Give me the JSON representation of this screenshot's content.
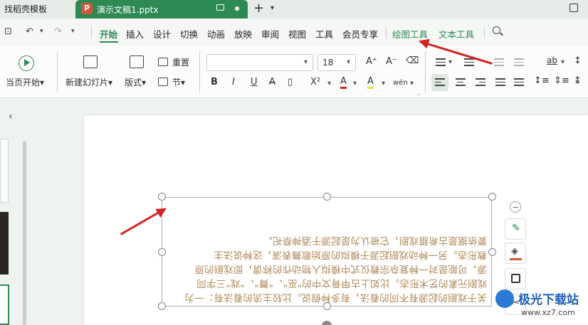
{
  "titlebar": {
    "tab_template": "找稻壳模板",
    "tab_doc": "演示文稿1.pptx",
    "doc_icon_letter": "P",
    "new_tab": "+"
  },
  "menu": {
    "items": [
      "开始",
      "插入",
      "设计",
      "切换",
      "动画",
      "放映",
      "审阅",
      "视图",
      "工具",
      "会员专享"
    ],
    "context_items": [
      "绘图工具",
      "文本工具"
    ],
    "active": "开始"
  },
  "ribbon": {
    "start_from_first": "当页开始",
    "new_slide": "新建幻灯片",
    "layout": "版式",
    "reset": "重置",
    "section": "节",
    "font_name": "",
    "font_size": "18",
    "format_buttons": [
      "B",
      "I",
      "U",
      "A",
      "X²",
      "A",
      "A",
      "ab"
    ],
    "size_up": "A⁺",
    "size_down": "A⁻",
    "wen": "wén"
  },
  "slide": {
    "text_lines": [
      "要依据是古希腊戏剧，它被认为是起源于酒神祭祀。",
      "教形态。另一种动戏剧起源于模拟的原始歌舞表演，这种说法主",
      "源，可能是对一种复杂宗教仪式中模拟人物动作的称谓，即戏剧的原",
      "戏剧元素的艺术形态。比如上古甲骨文中的\"巫\"、\"舞\"、\"戏\"三字同",
      "关于戏剧的起源有不同的看法，有多种假说。比较主流的看法有：一为"
    ]
  },
  "watermark": {
    "title": "极光下载站",
    "url": "www.xz7.com"
  },
  "colors": {
    "accent": "#2e8a55",
    "text_color": "#b08a5b",
    "arrow": "#d42121"
  }
}
